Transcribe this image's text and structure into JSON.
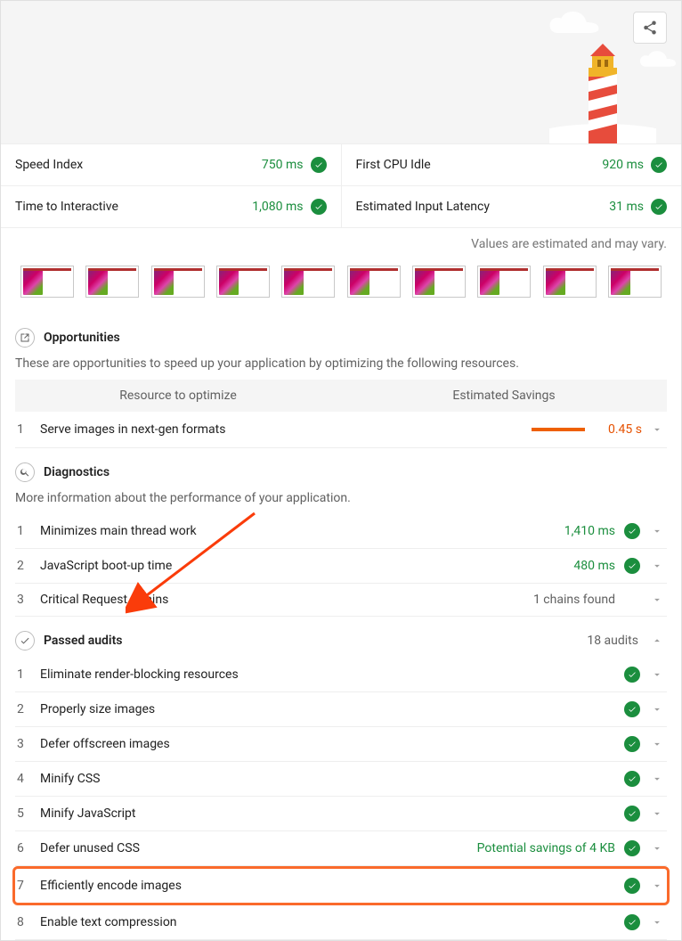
{
  "metrics_left": [
    {
      "name": "Speed Index",
      "value": "750 ms"
    },
    {
      "name": "Time to Interactive",
      "value": "1,080 ms"
    }
  ],
  "metrics_right": [
    {
      "name": "First CPU Idle",
      "value": "920 ms"
    },
    {
      "name": "Estimated Input Latency",
      "value": "31 ms"
    }
  ],
  "estimate_note": "Values are estimated and may vary.",
  "opportunities": {
    "title": "Opportunities",
    "desc": "These are opportunities to speed up your application by optimizing the following resources.",
    "col_resource": "Resource to optimize",
    "col_savings": "Estimated Savings",
    "items": [
      {
        "num": "1",
        "name": "Serve images in next-gen formats",
        "savings": "0.45 s"
      }
    ]
  },
  "diagnostics": {
    "title": "Diagnostics",
    "desc": "More information about the performance of your application.",
    "items": [
      {
        "num": "1",
        "name": "Minimizes main thread work",
        "value": "1,410 ms",
        "type": "green"
      },
      {
        "num": "2",
        "name": "JavaScript boot-up time",
        "value": "480 ms",
        "type": "green"
      },
      {
        "num": "3",
        "name": "Critical Request Chains",
        "value": "1 chains found",
        "type": "gray"
      }
    ]
  },
  "passed": {
    "title": "Passed audits",
    "count_label": "18 audits",
    "items": [
      {
        "num": "1",
        "name": "Eliminate render-blocking resources",
        "value": "",
        "type": "green"
      },
      {
        "num": "2",
        "name": "Properly size images",
        "value": "",
        "type": "green"
      },
      {
        "num": "3",
        "name": "Defer offscreen images",
        "value": "",
        "type": "green"
      },
      {
        "num": "4",
        "name": "Minify CSS",
        "value": "",
        "type": "green"
      },
      {
        "num": "5",
        "name": "Minify JavaScript",
        "value": "",
        "type": "green"
      },
      {
        "num": "6",
        "name": "Defer unused CSS",
        "value": "Potential savings of 4 KB",
        "type": "green"
      },
      {
        "num": "7",
        "name": "Efficiently encode images",
        "value": "",
        "type": "green",
        "highlight": true
      },
      {
        "num": "8",
        "name": "Enable text compression",
        "value": "",
        "type": "green"
      }
    ]
  }
}
